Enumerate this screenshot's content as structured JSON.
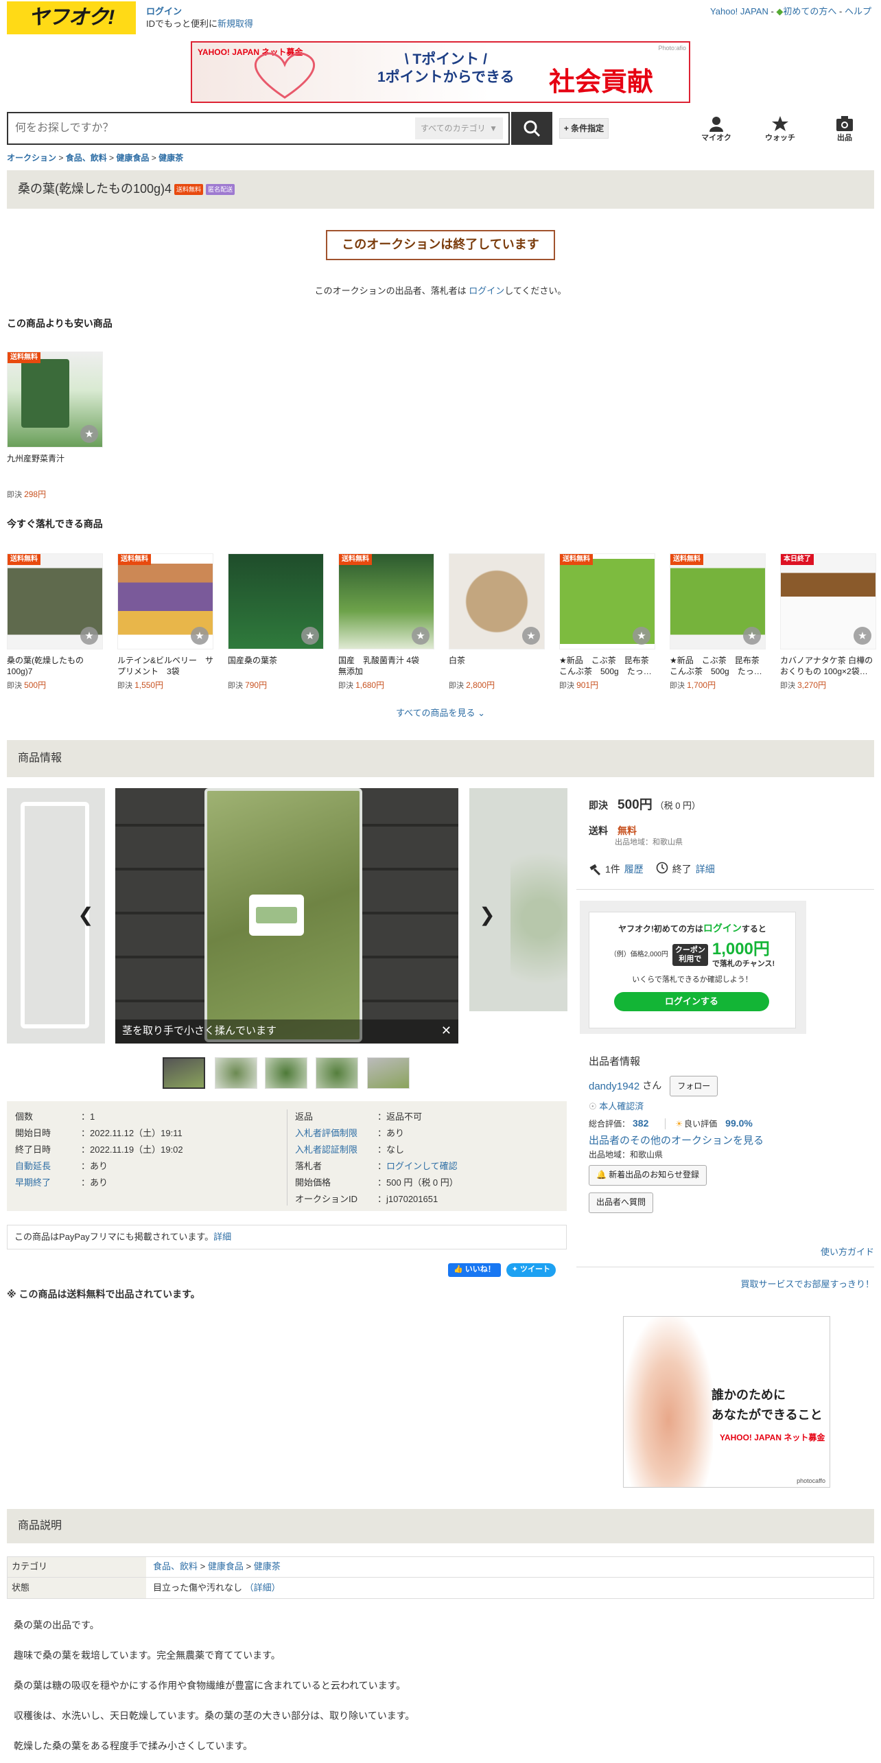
{
  "header": {
    "logo": "ヤフオク!",
    "login": "ログイン",
    "login_sub": "IDでもっと便利に",
    "register": "新規取得",
    "yahoo_japan": "Yahoo! JAPAN",
    "beginners": "初めての方へ",
    "help": "ヘルプ"
  },
  "banner": {
    "brand": "YAHOO! JAPAN ネット募金",
    "line1": "\\ Tポイント /",
    "line2": "1ポイントからできる",
    "line3": "社会貢献",
    "credit": "Photo:afio"
  },
  "search": {
    "placeholder": "何をお探しですか？",
    "category": "すべてのカテゴリ",
    "conditions": "+ 条件指定"
  },
  "header_icons": [
    {
      "label": "マイオク",
      "icon": "person-icon"
    },
    {
      "label": "ウォッチ",
      "icon": "star-icon"
    },
    {
      "label": "出品",
      "icon": "camera-icon"
    }
  ],
  "breadcrumb": [
    "オークション",
    "食品、飲料",
    "健康食品",
    "健康茶"
  ],
  "title": {
    "text": "桑の葉(乾燥したもの100g)4",
    "badge_free": "送料無料",
    "badge_anon": "匿名配送"
  },
  "ended": "このオークションは終了しています",
  "ended_note": {
    "before": "このオークションの出品者、落札者は ",
    "link": "ログイン",
    "after": "してください。"
  },
  "cheaper": {
    "heading": "この商品よりも安い商品",
    "items": [
      {
        "tag": "送料無料",
        "name": "九州産野菜青汁",
        "price_label": "即決",
        "price": "298円"
      }
    ]
  },
  "buynow": {
    "heading": "今すぐ落札できる商品",
    "items": [
      {
        "tag": "送料無料",
        "name": "桑の葉(乾燥したもの100g)7",
        "price_label": "即決",
        "price": "500円"
      },
      {
        "tag": "送料無料",
        "name": "ルテイン&ビルベリー　サプリメント　3袋",
        "price_label": "即決",
        "price": "1,550円"
      },
      {
        "tag": "",
        "name": "国産桑の葉茶",
        "price_label": "即決",
        "price": "790円"
      },
      {
        "tag": "送料無料",
        "name": "国産　乳酸菌青汁 4袋　無添加",
        "price_label": "即決",
        "price": "1,680円"
      },
      {
        "tag": "",
        "name": "白茶",
        "price_label": "即決",
        "price": "2,800円"
      },
      {
        "tag": "送料無料",
        "name": "★新品　こぶ茶　昆布茶　こんぶ茶　500g　たっ…",
        "price_label": "即決",
        "price": "901円"
      },
      {
        "tag": "送料無料",
        "name": "★新品　こぶ茶　昆布茶　こんぶ茶　500g　たっ…",
        "price_label": "即決",
        "price": "1,700円"
      },
      {
        "tag": "本日終了",
        "name": "カバノアナタケ茶 白樺のおくりもの 100g×2袋…",
        "price_label": "即決",
        "price": "3,270円"
      }
    ],
    "see_all": "すべての商品を見る"
  },
  "product_info": {
    "heading": "商品情報",
    "caption": "茎を取り手で小さく揉んでいます"
  },
  "details": {
    "left": [
      {
        "k": "個数",
        "v": "1",
        "link": false
      },
      {
        "k": "開始日時",
        "v": "2022.11.12（土）19:11",
        "link": false
      },
      {
        "k": "終了日時",
        "v": "2022.11.19（土）19:02",
        "link": false
      },
      {
        "k": "自動延長",
        "v": "あり",
        "link": true
      },
      {
        "k": "早期終了",
        "v": "あり",
        "link": true
      }
    ],
    "right": [
      {
        "k": "返品",
        "v": "返品不可",
        "link": false
      },
      {
        "k": "入札者評価制限",
        "v": "あり",
        "link": true
      },
      {
        "k": "入札者認証制限",
        "v": "なし",
        "link": true
      },
      {
        "k": "落札者",
        "v": "ログインして確認",
        "link": false
      },
      {
        "k": "開始価格",
        "v": "500 円（税 0 円）",
        "link": false
      },
      {
        "k": "オークションID",
        "v": "j1070201651",
        "link": false
      }
    ]
  },
  "paypay": {
    "text": "この商品はPayPayフリマにも掲載されています。",
    "link": "詳細"
  },
  "social": {
    "like": "いいね！",
    "tweet": "ツイート"
  },
  "ship_note": "※ この商品は送料無料で出品されています。",
  "price": {
    "label": "即決",
    "value": "500円",
    "tax": "（税 0 円）",
    "shipping_label": "送料",
    "shipping_value": "無料",
    "region": "出品地域：和歌山県"
  },
  "bids": {
    "count": "1件",
    "history": "履歴",
    "status": "終了",
    "detail": "詳細"
  },
  "promo": {
    "line1_a": "ヤフオク!初めての方は",
    "line1_link": "ログイン",
    "line1_b": "すると",
    "example": "（例）価格2,000円",
    "coupon": "クーポン利用で",
    "amount": "1,000円",
    "chance": "で落札のチャンス!",
    "note": "いくらで落札できるか確認しよう！",
    "button": "ログインする"
  },
  "seller": {
    "heading": "出品者情報",
    "name": "dandy1942",
    "san": "さん",
    "follow": "フォロー",
    "verified": "本人確認済",
    "rating_label": "総合評価：",
    "rating": "382",
    "good_label": "良い評価",
    "good": "99.0%",
    "other_link": "出品者のその他のオークションを見る",
    "region": "出品地域：和歌山県",
    "notify_btn": "新着出品のお知らせ登録",
    "question_btn": "出品者へ質問"
  },
  "guide": "使い方ガイド",
  "kaitori": "買取サービスでお部屋すっきり！",
  "ad2": {
    "line1": "誰かのために",
    "line2": "あなたができること",
    "brand": "YAHOO! JAPAN ネット募金",
    "credit": "photocaffo"
  },
  "description": {
    "heading": "商品説明",
    "category_label": "カテゴリ",
    "category": [
      "食品、飲料",
      "健康食品",
      "健康茶"
    ],
    "condition_label": "状態",
    "condition": "目立った傷や汚れなし",
    "condition_link": "（詳細）",
    "paragraphs": [
      "桑の葉の出品です。",
      "趣味で桑の葉を栽培しています。完全無農薬で育てています。",
      "桑の葉は糖の吸収を穏やかにする作用や食物繊維が豊富に含まれていると云われています。",
      "収穫後は、水洗いし、天日乾燥しています。桑の葉の茎の大きい部分は、取り除いています。",
      "乾燥した桑の葉をある程度手で揉み小さくしています。"
    ]
  },
  "colors": {
    "accent": "#2e6ea5",
    "price": "#c7511f",
    "brand": "#ffda16",
    "section": "#e7e6df"
  }
}
